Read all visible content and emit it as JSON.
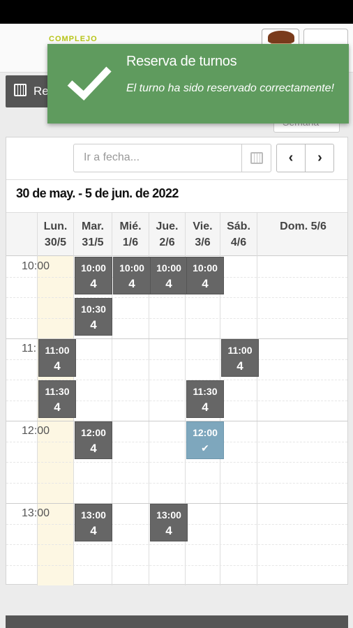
{
  "header": {
    "logo_text": "COMPLEJO"
  },
  "page_button_label": "Re",
  "view_select_label": "Semana",
  "toast": {
    "title": "Reserva de turnos",
    "message": "El turno ha sido reservado correctamente!",
    "color": "#5f9b5e"
  },
  "toolbar": {
    "date_placeholder": "Ir a fecha...",
    "prev_icon": "chevron-left-icon",
    "next_icon": "chevron-right-icon"
  },
  "range_title": "30 de may. - 5 de jun. de 2022",
  "days": [
    {
      "name": "Lun.",
      "date": "30/5"
    },
    {
      "name": "Mar.",
      "date": "31/5"
    },
    {
      "name": "Mié.",
      "date": "1/6"
    },
    {
      "name": "Jue.",
      "date": "2/6"
    },
    {
      "name": "Vie.",
      "date": "3/6"
    },
    {
      "name": "Sáb.",
      "date": "4/6"
    },
    {
      "name": "Dom. 5/6",
      "date": ""
    }
  ],
  "time_labels": [
    "10:00",
    "11:",
    "12:00",
    "13:00"
  ],
  "slots": [
    {
      "day": 1,
      "time": "10:00",
      "count": "4"
    },
    {
      "day": 2,
      "time": "10:00",
      "count": "4"
    },
    {
      "day": 3,
      "time": "10:00",
      "count": "4"
    },
    {
      "day": 4,
      "time": "10:00",
      "count": "4"
    },
    {
      "day": 1,
      "time": "10:30",
      "count": "4"
    },
    {
      "day": 0,
      "time": "11:00",
      "count": "4"
    },
    {
      "day": 5,
      "time": "11:00",
      "count": "4"
    },
    {
      "day": 0,
      "time": "11:30",
      "count": "4"
    },
    {
      "day": 4,
      "time": "11:30",
      "count": "4"
    },
    {
      "day": 1,
      "time": "12:00",
      "count": "4"
    },
    {
      "day": 4,
      "time": "12:00",
      "count": "✔",
      "reserved": true
    },
    {
      "day": 1,
      "time": "13:00",
      "count": "4"
    },
    {
      "day": 3,
      "time": "13:00",
      "count": "4"
    }
  ],
  "colors": {
    "slot": "#666666",
    "reserved_slot": "#7ea7bd",
    "today_column": "#fdf7e3"
  }
}
